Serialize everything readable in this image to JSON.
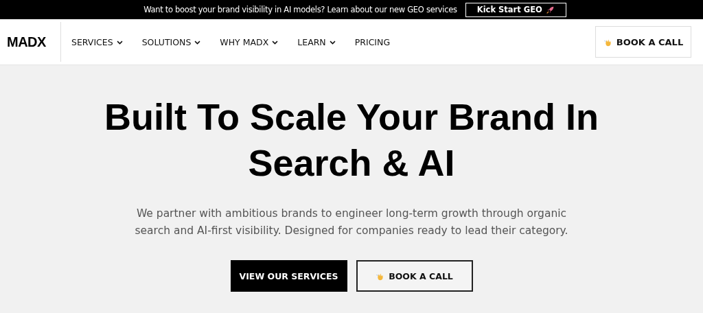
{
  "announcement": {
    "text": "Want to boost your brand visibility in AI models? Learn about our new GEO services",
    "button": "Kick Start GEO"
  },
  "nav": {
    "logo": "MADX",
    "items": [
      {
        "label": "SERVICES",
        "dropdown": true
      },
      {
        "label": "SOLUTIONS",
        "dropdown": true
      },
      {
        "label": "WHY MADX",
        "dropdown": true
      },
      {
        "label": "LEARN",
        "dropdown": true
      },
      {
        "label": "PRICING",
        "dropdown": false
      }
    ],
    "cta": "BOOK A CALL"
  },
  "hero": {
    "title_lines": [
      "Built To Scale Your Brand In",
      "Search & AI"
    ],
    "description": "We partner with ambitious brands to engineer long-term growth through organic search and AI-first visibility. Designed for companies ready to lead their category.",
    "buttons": [
      {
        "label": "VIEW OUR SERVICES",
        "kind": "primary"
      },
      {
        "label": "BOOK A CALL",
        "kind": "outline"
      }
    ]
  }
}
